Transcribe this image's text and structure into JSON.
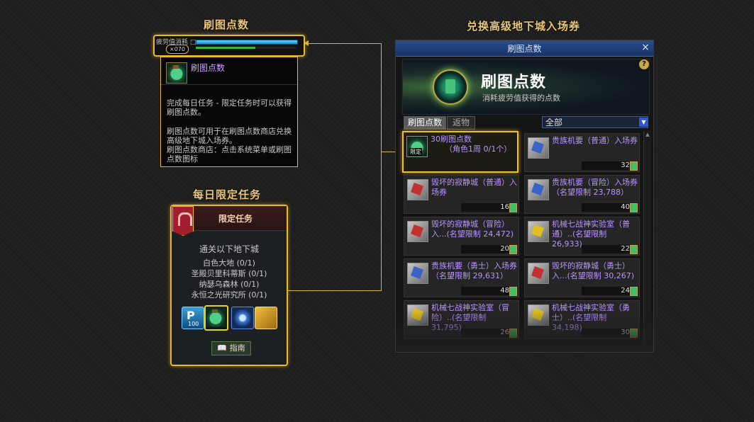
{
  "headings": {
    "points": "刷图点数",
    "daily": "每日限定任务",
    "exchange": "兑换高级地下城入场券"
  },
  "bar": {
    "label": "疲劳值消耗 □",
    "count": "×070"
  },
  "tooltip": {
    "title": "刷图点数",
    "p1": "完成每日任务 - 限定任务时可以获得刷图点数。",
    "p2": "刷图点数可用于在刷图点数商店兑换高级地下城入场券。",
    "p3": "刷图点数商店：点击系统菜单或刷图点数图标"
  },
  "task": {
    "title": "限定任务",
    "subtitle": "通关以下地下城",
    "dungeons": [
      "白色大地 (0/1)",
      "圣殿贝里科蒂斯 (0/1)",
      "纳瑟乌森林 (0/1)",
      "永恒之光研究所 (0/1)"
    ],
    "reward_p_top": "P",
    "reward_p_num": "100",
    "guide": "指南"
  },
  "dialog": {
    "title": "刷图点数",
    "close": "×",
    "banner_title": "刷图点数",
    "banner_sub": "消耗疲劳值获得的点数",
    "help": "?",
    "tabs": [
      "刷图点数",
      "返物"
    ],
    "filter": "全部",
    "filter_arrow": "▼",
    "scroll_up": "▲",
    "limited_tag": "限定",
    "items": [
      {
        "name": "30刷图点数",
        "sub": "（角色1周 0/1个）",
        "price": ""
      },
      {
        "name": "贵族机要（普通）入场券",
        "sub": "",
        "price": "32"
      },
      {
        "name": "毁坏的寂静城（普通）入场券",
        "sub": "",
        "price": "16"
      },
      {
        "name": "贵族机要（冒险）入场券（名望限制 23,788）",
        "sub": "",
        "price": "40"
      },
      {
        "name": "毁坏的寂静城（冒险）入...(名望限制 24,472)",
        "sub": "",
        "price": "20"
      },
      {
        "name": "机械七战神实验室（普通）..(名望限制 26,933)",
        "sub": "",
        "price": "22"
      },
      {
        "name": "贵族机要（勇士）入场券（名望限制 29,631）",
        "sub": "",
        "price": "48"
      },
      {
        "name": "毁坏的寂静城（勇士）入...(名望限制 30,267)",
        "sub": "",
        "price": "24"
      },
      {
        "name": "机械七战神实验室（冒险）..(名望限制 31,795)",
        "sub": "",
        "price": "26"
      },
      {
        "name": "机械七战神实验室（勇士）..(名望限制 34,198)",
        "sub": "",
        "price": "30"
      }
    ]
  }
}
